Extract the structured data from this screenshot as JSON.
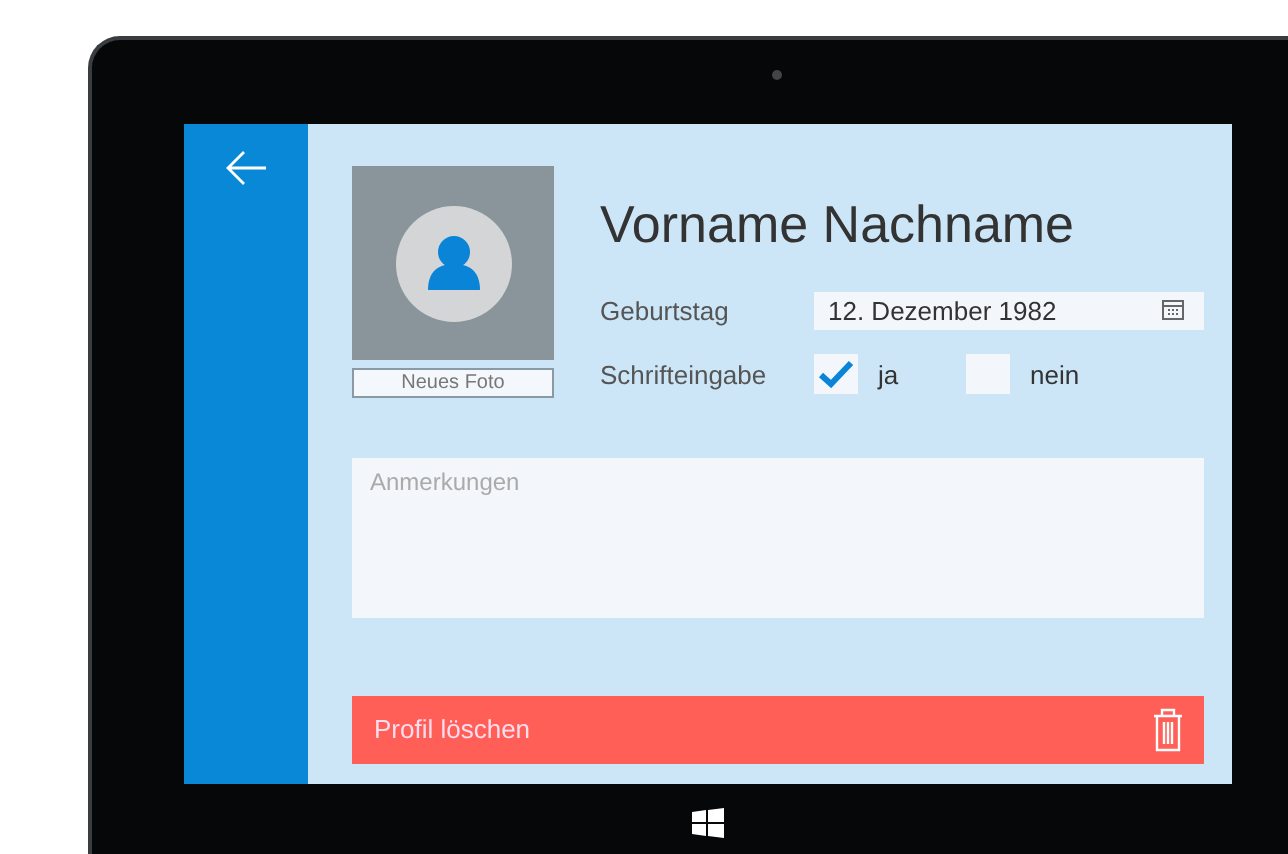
{
  "profile": {
    "name": "Vorname Nachname",
    "photo_button": "Neues Foto",
    "birthday": {
      "label": "Geburtstag",
      "value": "12. Dezember 1982"
    },
    "handwriting": {
      "label": "Schrifteingabe",
      "options": [
        {
          "label": "ja",
          "checked": true
        },
        {
          "label": "nein",
          "checked": false
        }
      ]
    },
    "notes": {
      "placeholder": "Anmerkungen"
    },
    "delete_button": "Profil löschen"
  }
}
